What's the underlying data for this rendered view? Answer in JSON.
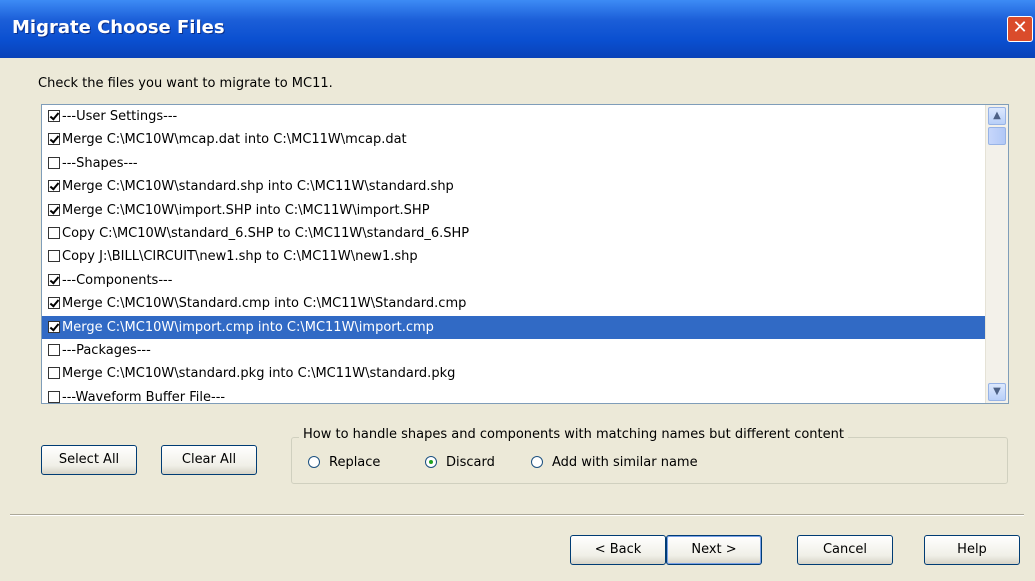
{
  "window": {
    "title": "Migrate Choose Files",
    "close_glyph": "✕"
  },
  "instruction": "Check the files you want to migrate to MC11.",
  "files": [
    {
      "label": "---User Settings---",
      "checked": true,
      "selected": false
    },
    {
      "label": "Merge C:\\MC10W\\mcap.dat into C:\\MC11W\\mcap.dat",
      "checked": true,
      "selected": false
    },
    {
      "label": "---Shapes---",
      "checked": false,
      "selected": false
    },
    {
      "label": "Merge C:\\MC10W\\standard.shp into C:\\MC11W\\standard.shp",
      "checked": true,
      "selected": false
    },
    {
      "label": "Merge C:\\MC10W\\import.SHP into C:\\MC11W\\import.SHP",
      "checked": true,
      "selected": false
    },
    {
      "label": "Copy C:\\MC10W\\standard_6.SHP to C:\\MC11W\\standard_6.SHP",
      "checked": false,
      "selected": false
    },
    {
      "label": "Copy J:\\BILL\\CIRCUIT\\new1.shp to C:\\MC11W\\new1.shp",
      "checked": false,
      "selected": false
    },
    {
      "label": "---Components---",
      "checked": true,
      "selected": false
    },
    {
      "label": "Merge C:\\MC10W\\Standard.cmp into C:\\MC11W\\Standard.cmp",
      "checked": true,
      "selected": false
    },
    {
      "label": "Merge C:\\MC10W\\import.cmp into C:\\MC11W\\import.cmp",
      "checked": true,
      "selected": true
    },
    {
      "label": "---Packages---",
      "checked": false,
      "selected": false
    },
    {
      "label": "Merge C:\\MC10W\\standard.pkg into C:\\MC11W\\standard.pkg",
      "checked": false,
      "selected": false
    },
    {
      "label": "---Waveform Buffer File---",
      "checked": false,
      "selected": false
    }
  ],
  "scrollbar": {
    "up_glyph": "▲",
    "down_glyph": "▼"
  },
  "buttons": {
    "select_all": "Select All",
    "clear_all": "Clear All",
    "back": "< Back",
    "next": "Next >",
    "cancel": "Cancel",
    "help": "Help"
  },
  "conflict_group": {
    "legend": "How to handle shapes and components with matching names but different content",
    "options": [
      {
        "label": "Replace",
        "selected": false
      },
      {
        "label": "Discard",
        "selected": true
      },
      {
        "label": "Add with similar name",
        "selected": false
      }
    ]
  }
}
